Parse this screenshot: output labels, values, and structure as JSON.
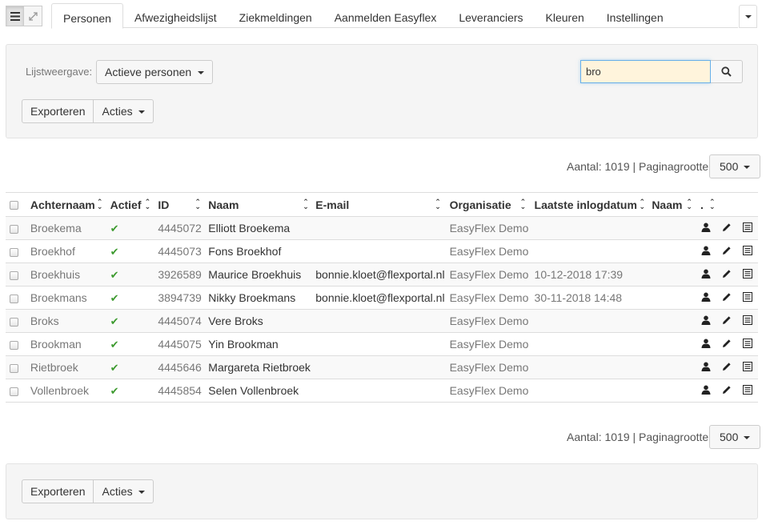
{
  "nav": {
    "tabs": [
      "Personen",
      "Afwezigheidslijst",
      "Ziekmeldingen",
      "Aanmelden Easyflex",
      "Leveranciers",
      "Kleuren",
      "Instellingen"
    ],
    "active_tab": "Personen"
  },
  "filter": {
    "list_view_label": "Lijstweergave:",
    "list_view_value": "Actieve personen",
    "search_value": "bro",
    "export_label": "Exporteren",
    "actions_label": "Acties"
  },
  "pager": {
    "count_text": "Aantal: 1019 | Paginagrootte:",
    "page_size": "500"
  },
  "table": {
    "columns": [
      "Achternaam",
      "Actief",
      "ID",
      "Naam",
      "E-mail",
      "Organisatie",
      "Laatste inlogdatum",
      "Naam",
      "."
    ],
    "rows": [
      {
        "achternaam": "Broekema",
        "id": "4445072",
        "naam": "Elliott Broekema",
        "email": "",
        "organisatie": "EasyFlex Demo",
        "login": ""
      },
      {
        "achternaam": "Broekhof",
        "id": "4445073",
        "naam": "Fons Broekhof",
        "email": "",
        "organisatie": "EasyFlex Demo",
        "login": ""
      },
      {
        "achternaam": "Broekhuis",
        "id": "3926589",
        "naam": "Maurice Broekhuis",
        "email": "bonnie.kloet@flexportal.nl",
        "organisatie": "EasyFlex Demo",
        "login": "10-12-2018 17:39"
      },
      {
        "achternaam": "Broekmans",
        "id": "3894739",
        "naam": "Nikky Broekmans",
        "email": "bonnie.kloet@flexportal.nl",
        "organisatie": "EasyFlex Demo",
        "login": "30-11-2018 14:48"
      },
      {
        "achternaam": "Broks",
        "id": "4445074",
        "naam": "Vere Broks",
        "email": "",
        "organisatie": "EasyFlex Demo",
        "login": ""
      },
      {
        "achternaam": "Brookman",
        "id": "4445075",
        "naam": "Yin Brookman",
        "email": "",
        "organisatie": "EasyFlex Demo",
        "login": ""
      },
      {
        "achternaam": "Rietbroek",
        "id": "4445646",
        "naam": "Margareta Rietbroek",
        "email": "",
        "organisatie": "EasyFlex Demo",
        "login": ""
      },
      {
        "achternaam": "Vollenbroek",
        "id": "4445854",
        "naam": "Selen Vollenbroek",
        "email": "",
        "organisatie": "EasyFlex Demo",
        "login": ""
      }
    ]
  },
  "icons": {
    "active": "check-icon",
    "row_actions": [
      "user-icon",
      "pencil-icon",
      "list-icon"
    ]
  }
}
